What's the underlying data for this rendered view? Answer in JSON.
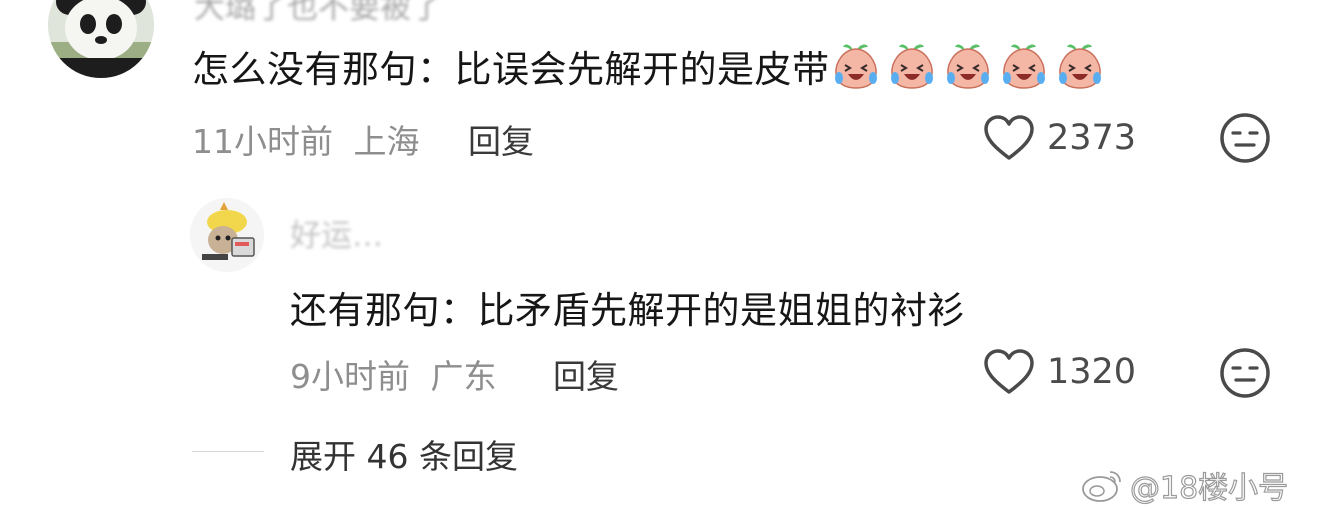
{
  "comment": {
    "username": "大璐了也不要被了",
    "text": "怎么没有那句：比误会先解开的是皮带",
    "emoji_icon": "laughing-crying-peach-emoji",
    "emoji_count": 5,
    "time": "11小时前",
    "location": "上海",
    "reply_label": "回复",
    "likes": "2373"
  },
  "reply": {
    "username": "好运…",
    "text": "还有那句：比矛盾先解开的是姐姐的衬衫",
    "time": "9小时前",
    "location": "广东",
    "reply_label": "回复",
    "likes": "1320"
  },
  "expand": {
    "label": "展开 46 条回复"
  },
  "watermark": {
    "text": "@18楼小号"
  },
  "colors": {
    "text_primary": "#161616",
    "text_meta": "#8e8e8e",
    "icon_stroke": "#4a4a4a",
    "emoji_face": "#f4b7a6"
  }
}
